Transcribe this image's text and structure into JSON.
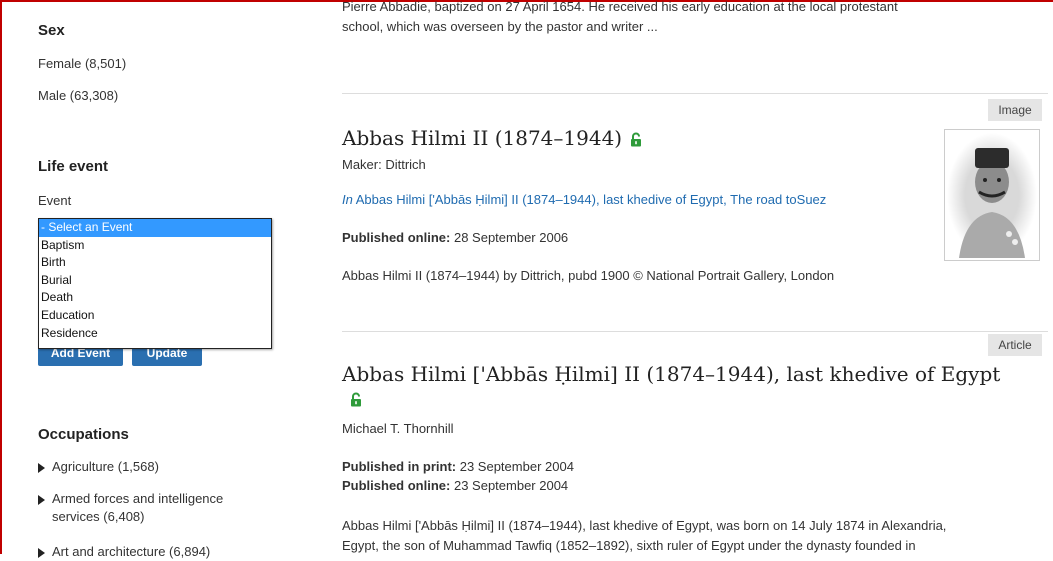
{
  "sidebar": {
    "sex_heading": "Sex",
    "sex_items": [
      "Female (8,501)",
      "Male (63,308)"
    ],
    "life_event_heading": "Life event",
    "event_label": "Event",
    "event_options": [
      "- Select an Event",
      "Baptism",
      "Birth",
      "Burial",
      "Death",
      "Education",
      "Residence"
    ],
    "add_event_label": "Add Event",
    "update_label": "Update",
    "occupations_heading": "Occupations",
    "occupations": [
      "Agriculture (1,568)",
      "Armed forces and intelligence",
      "services (6,408)",
      "Art and architecture (6,894)"
    ]
  },
  "main": {
    "top_snippet_line1": "Pierre Abbadie, baptized on 27 April 1654. He received his early education at the local protestant",
    "top_snippet_line2": "school, which was overseen by the pastor and writer ...",
    "result1": {
      "tag": "Image",
      "title": "Abbas Hilmi II (1874–1944)",
      "maker": "Maker: Dittrich",
      "in_prefix": "In",
      "link1": "Abbas Hilmi ['Abbās Ḥilmi] II (1874–1944), last khedive of Egypt",
      "link_sep": ",",
      "link2": "The road toSuez",
      "published_label": "Published online:",
      "published_value": "28 September 2006",
      "caption": "Abbas Hilmi II (1874–1944) by Dittrich, pubd 1900 © National Portrait Gallery, London",
      "image_alt": "Portrait photograph of Abbas Hilmi II"
    },
    "result2": {
      "tag": "Article",
      "title": "Abbas Hilmi ['Abbās Ḥilmi] II (1874–1944), last khedive of Egypt",
      "author": "Michael T. Thornhill",
      "print_label": "Published in print:",
      "print_value": "23 September 2004",
      "online_label": "Published online:",
      "online_value": "23 September 2004",
      "snippet_line1": "Abbas Hilmi ['Abbās Ḥilmi] II (1874–1944), last khedive of Egypt, was born on 14 July 1874 in Alexandria,",
      "snippet_line2": "Egypt, the son of Muhammad Tawfiq (1852–1892), sixth ruler of Egypt under the dynasty founded in"
    }
  },
  "colors": {
    "frame": "#c00000",
    "link": "#1f6bb0",
    "button": "#2a6fb0",
    "lock": "#2e9b3a",
    "selected_option": "#3399ff"
  }
}
